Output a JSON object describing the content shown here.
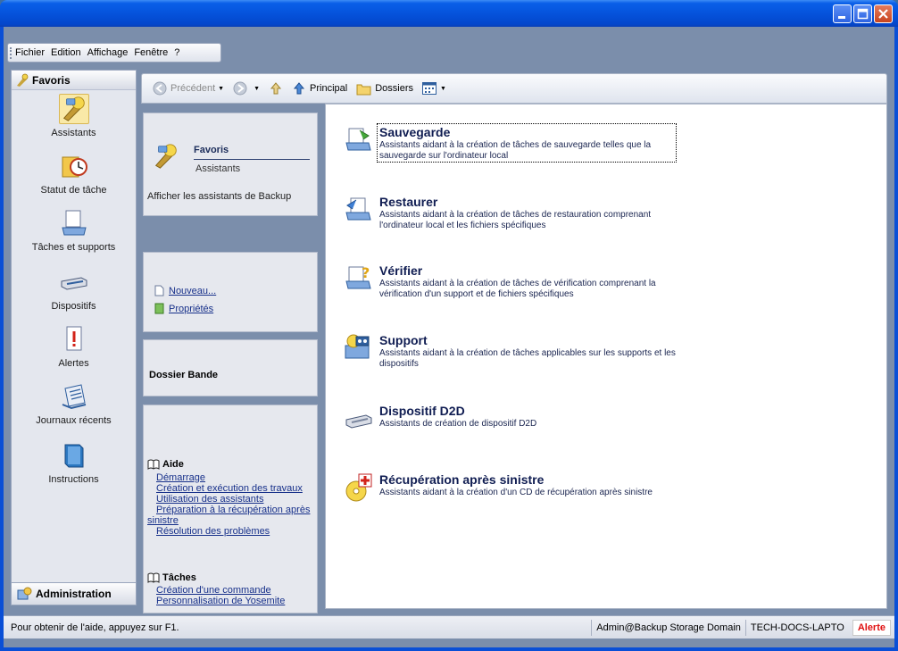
{
  "menu": {
    "items": [
      "Fichier",
      "Edition",
      "Affichage",
      "Fenêtre",
      "?"
    ]
  },
  "sidebar": {
    "header": "Favoris",
    "items": [
      {
        "label": "Assistants",
        "icon": "wizard-icon"
      },
      {
        "label": "Statut de tâche",
        "icon": "task-status-icon"
      },
      {
        "label": "Tâches et supports",
        "icon": "tasks-media-icon"
      },
      {
        "label": "Dispositifs",
        "icon": "devices-icon"
      },
      {
        "label": "Alertes",
        "icon": "alerts-icon"
      },
      {
        "label": "Journaux récents",
        "icon": "logs-icon"
      },
      {
        "label": "Instructions",
        "icon": "instructions-icon"
      }
    ],
    "admin": "Administration"
  },
  "toolbar": {
    "back": "Précédent",
    "home": "Principal",
    "folders": "Dossiers"
  },
  "leftpanel": {
    "favorites": {
      "title": "Favoris",
      "subtitle": "Assistants",
      "desc": "Afficher les assistants de Backup"
    },
    "actions": {
      "new": "Nouveau...",
      "properties": "Propriétés"
    },
    "folder": "Dossier Bande",
    "help": {
      "title": "Aide",
      "links": [
        "Démarrage",
        "Création et exécution des travaux",
        "Utilisation des assistants",
        "Préparation à la récupération après",
        "Résolution des problèmes"
      ],
      "wrap": "sinistre"
    },
    "tasks": {
      "title": "Tâches",
      "links": [
        "Création d'une commande",
        "Personnalisation de Yosemite"
      ]
    }
  },
  "main": {
    "tasks": [
      {
        "title": "Sauvegarde",
        "desc": "Assistants aidant à la création de tâches de sauvegarde telles que la sauvegarde sur l'ordinateur local"
      },
      {
        "title": "Restaurer",
        "desc": "Assistants aidant à la création de tâches de restauration comprenant l'ordinateur local et les fichiers spécifiques"
      },
      {
        "title": "Vérifier",
        "desc": "Assistants aidant à la création de tâches de vérification comprenant la vérification d'un support et de fichiers spécifiques"
      },
      {
        "title": "Support",
        "desc": "Assistants aidant à la création de tâches applicables sur les supports et les dispositifs"
      },
      {
        "title": "Dispositif D2D",
        "desc": "Assistants de création de dispositif D2D"
      },
      {
        "title": "Récupération après sinistre",
        "desc": "Assistants aidant à la création d'un CD de récupération après sinistre"
      }
    ]
  },
  "status": {
    "hint": "Pour obtenir de l'aide, appuyez sur F1.",
    "domain": "Admin@Backup Storage Domain",
    "host": "TECH-DOCS-LAPTO",
    "alert": "Alerte"
  }
}
